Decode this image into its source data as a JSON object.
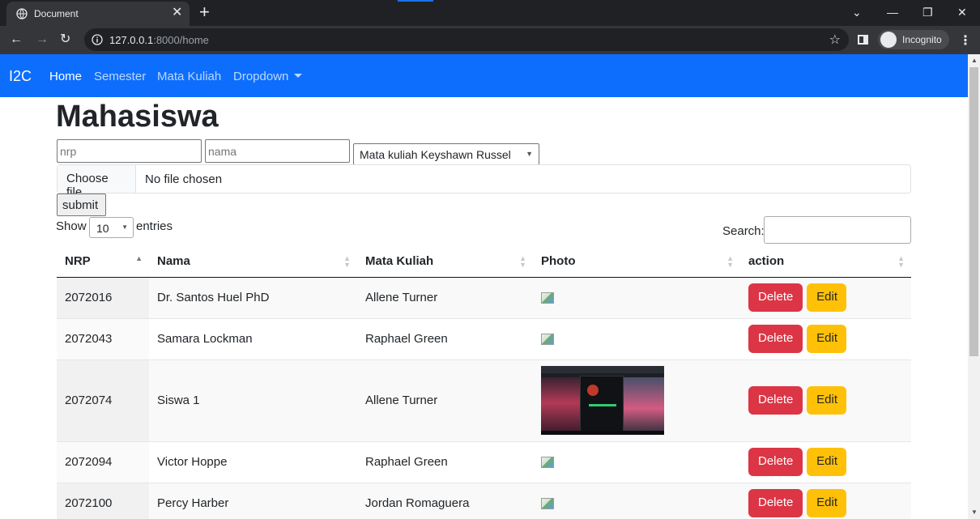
{
  "browser": {
    "tab_title": "Document",
    "url_host": "127.0.0.1",
    "url_rest": ":8000/home",
    "profile_label": "Incognito"
  },
  "navbar": {
    "brand": "I2C",
    "links": [
      {
        "label": "Home"
      },
      {
        "label": "Semester"
      },
      {
        "label": "Mata Kuliah"
      },
      {
        "label": "Dropdown"
      }
    ]
  },
  "page": {
    "title": "Mahasiswa"
  },
  "form": {
    "nrp_placeholder": "nrp",
    "nama_placeholder": "nama",
    "matkul_selected": "Mata kuliah Keyshawn Russel",
    "file_button": "Choose file",
    "file_status": "No file chosen",
    "submit_label": "submit"
  },
  "datatable": {
    "show_label": "Show",
    "length_value": "10",
    "entries_label": "entries",
    "search_label": "Search:",
    "columns": [
      "NRP",
      "Nama",
      "Mata Kuliah",
      "Photo",
      "action"
    ],
    "rows": [
      {
        "nrp": "2072016",
        "nama": "Dr. Santos Huel PhD",
        "matkul": "Allene Turner",
        "photo": "broken-image-icon"
      },
      {
        "nrp": "2072043",
        "nama": "Samara Lockman",
        "matkul": "Raphael Green",
        "photo": "broken-image-icon"
      },
      {
        "nrp": "2072074",
        "nama": "Siswa 1",
        "matkul": "Allene Turner",
        "photo": "screenshot-thumbnail"
      },
      {
        "nrp": "2072094",
        "nama": "Victor Hoppe",
        "matkul": "Raphael Green",
        "photo": "broken-image-icon"
      },
      {
        "nrp": "2072100",
        "nama": "Percy Harber",
        "matkul": "Jordan Romaguera",
        "photo": "broken-image-icon"
      }
    ],
    "delete_label": "Delete",
    "edit_label": "Edit"
  },
  "colors": {
    "navbar": "#0d6efd",
    "danger": "#dc3545",
    "warning": "#ffc107"
  }
}
